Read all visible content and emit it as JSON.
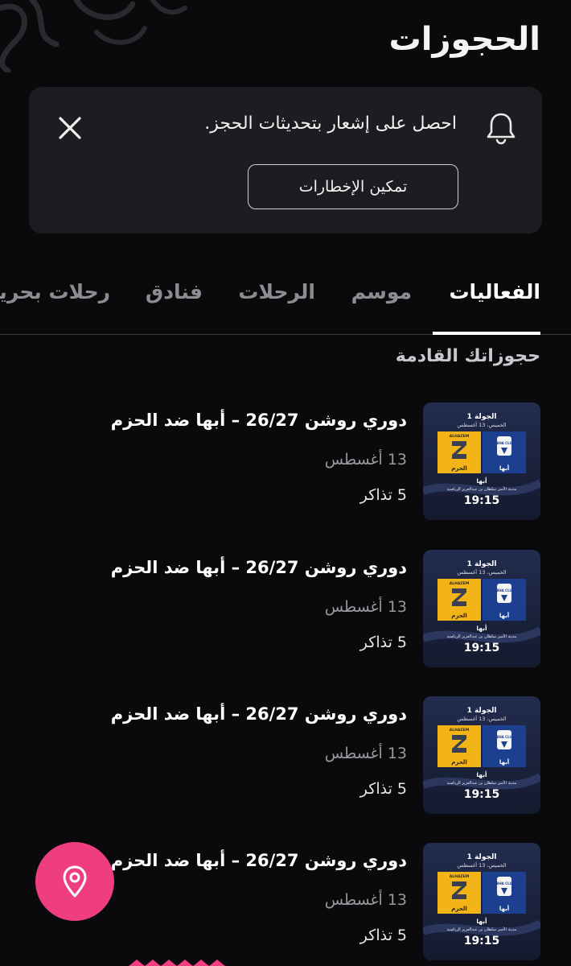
{
  "header": {
    "title": "الحجوزات"
  },
  "notification": {
    "message": "احصل على إشعار بتحديثات الحجز.",
    "enable_label": "تمكين الإخطارات"
  },
  "tabs": [
    {
      "label": "الفعاليات",
      "active": true
    },
    {
      "label": "موسم",
      "active": false
    },
    {
      "label": "الرحلات",
      "active": false
    },
    {
      "label": "فنادق",
      "active": false
    },
    {
      "label": "رحلات بحرية",
      "active": false
    }
  ],
  "upcoming": {
    "title": "حجوزاتك القادمة",
    "bookings": [
      {
        "title": "دوري روشن 26/27 – أبها ضد الحزم",
        "date": "13 أغسطس",
        "tickets": "5 تذاكر",
        "poster": {
          "round": "الجولة 1",
          "day": "الخميس، 13 أغسطس",
          "team_home": "أبها",
          "team_away": "الحزم",
          "city": "أبها",
          "venue": "مدينة الأمير سلطان بن عبدالعزيز الرياضية",
          "time": "19:15",
          "home_logo_text": "ABHA CLUB",
          "away_logo_text": "ALHAZEM"
        }
      },
      {
        "title": "دوري روشن 26/27 – أبها ضد الحزم",
        "date": "13 أغسطس",
        "tickets": "5 تذاكر",
        "poster": {
          "round": "الجولة 1",
          "day": "الخميس، 13 أغسطس",
          "team_home": "أبها",
          "team_away": "الحزم",
          "city": "أبها",
          "venue": "مدينة الأمير سلطان بن عبدالعزيز الرياضية",
          "time": "19:15",
          "home_logo_text": "ABHA CLUB",
          "away_logo_text": "ALHAZEM"
        }
      },
      {
        "title": "دوري روشن 26/27 – أبها ضد الحزم",
        "date": "13 أغسطس",
        "tickets": "5 تذاكر",
        "poster": {
          "round": "الجولة 1",
          "day": "الخميس، 13 أغسطس",
          "team_home": "أبها",
          "team_away": "الحزم",
          "city": "أبها",
          "venue": "مدينة الأمير سلطان بن عبدالعزيز الرياضية",
          "time": "19:15",
          "home_logo_text": "ABHA CLUB",
          "away_logo_text": "ALHAZEM"
        }
      },
      {
        "title": "دوري روشن 26/27 – أبها ضد الحزم",
        "date": "13 أغسطس",
        "tickets": "5 تذاكر",
        "poster": {
          "round": "الجولة 1",
          "day": "الخميس، 13 أغسطس",
          "team_home": "أبها",
          "team_away": "الحزم",
          "city": "أبها",
          "venue": "مدينة الأمير سلطان بن عبدالعزيز الرياضية",
          "time": "19:15",
          "home_logo_text": "ABHA CLUB",
          "away_logo_text": "ALHAZEM"
        }
      }
    ]
  },
  "icons": {
    "bell": "bell-icon",
    "close": "close-icon",
    "fab": "map-pin-icon"
  },
  "colors": {
    "background": "#0a090b",
    "card": "#1d1c20",
    "accent": "#ee3e80",
    "poster_navy": "#1a2340",
    "team_yellow": "#f2b416",
    "team_blue": "#1d3f8f"
  }
}
